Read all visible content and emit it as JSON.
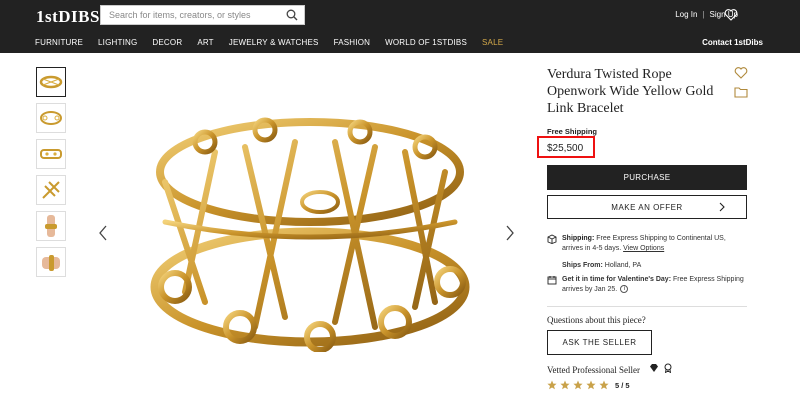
{
  "header": {
    "logo": "1stDIBS",
    "search_placeholder": "Search for items, creators, or styles",
    "login": "Log In",
    "separator": "|",
    "signup": "Sign Up",
    "nav": [
      "FURNITURE",
      "LIGHTING",
      "DECOR",
      "ART",
      "JEWELRY & WATCHES",
      "FASHION",
      "WORLD OF 1STDIBS"
    ],
    "sale": "SALE",
    "contact": "Contact 1stDibs",
    "sale_color": "#d4a94a"
  },
  "gallery": {
    "thumbnail_count": 6,
    "prev_icon": "chevron-left-icon",
    "next_icon": "chevron-right-icon"
  },
  "product": {
    "title": "Verdura Twisted Rope Openwork Wide Yellow Gold Link Bracelet",
    "free_shipping": "Free Shipping",
    "price": "$25,500",
    "purchase_label": "PURCHASE",
    "offer_label": "MAKE AN OFFER",
    "shipping_label": "Shipping:",
    "shipping_text": " Free Express Shipping to Continental US, arrives in 4-5 days. ",
    "view_options": "View Options",
    "ships_from_label": "Ships From:",
    "ships_from_value": " Holland, PA",
    "vday_label": "Get it in time for Valentine's Day:",
    "vday_text": " Free Express Shipping arrives by Jan 25.",
    "questions": "Questions about this piece?",
    "ask_label": "ASK THE SELLER",
    "vetted": "Vetted Professional Seller",
    "rating": "5 / 5",
    "stars": 5,
    "star_color": "#c9a24a",
    "highlight_color": "#ee1111"
  }
}
